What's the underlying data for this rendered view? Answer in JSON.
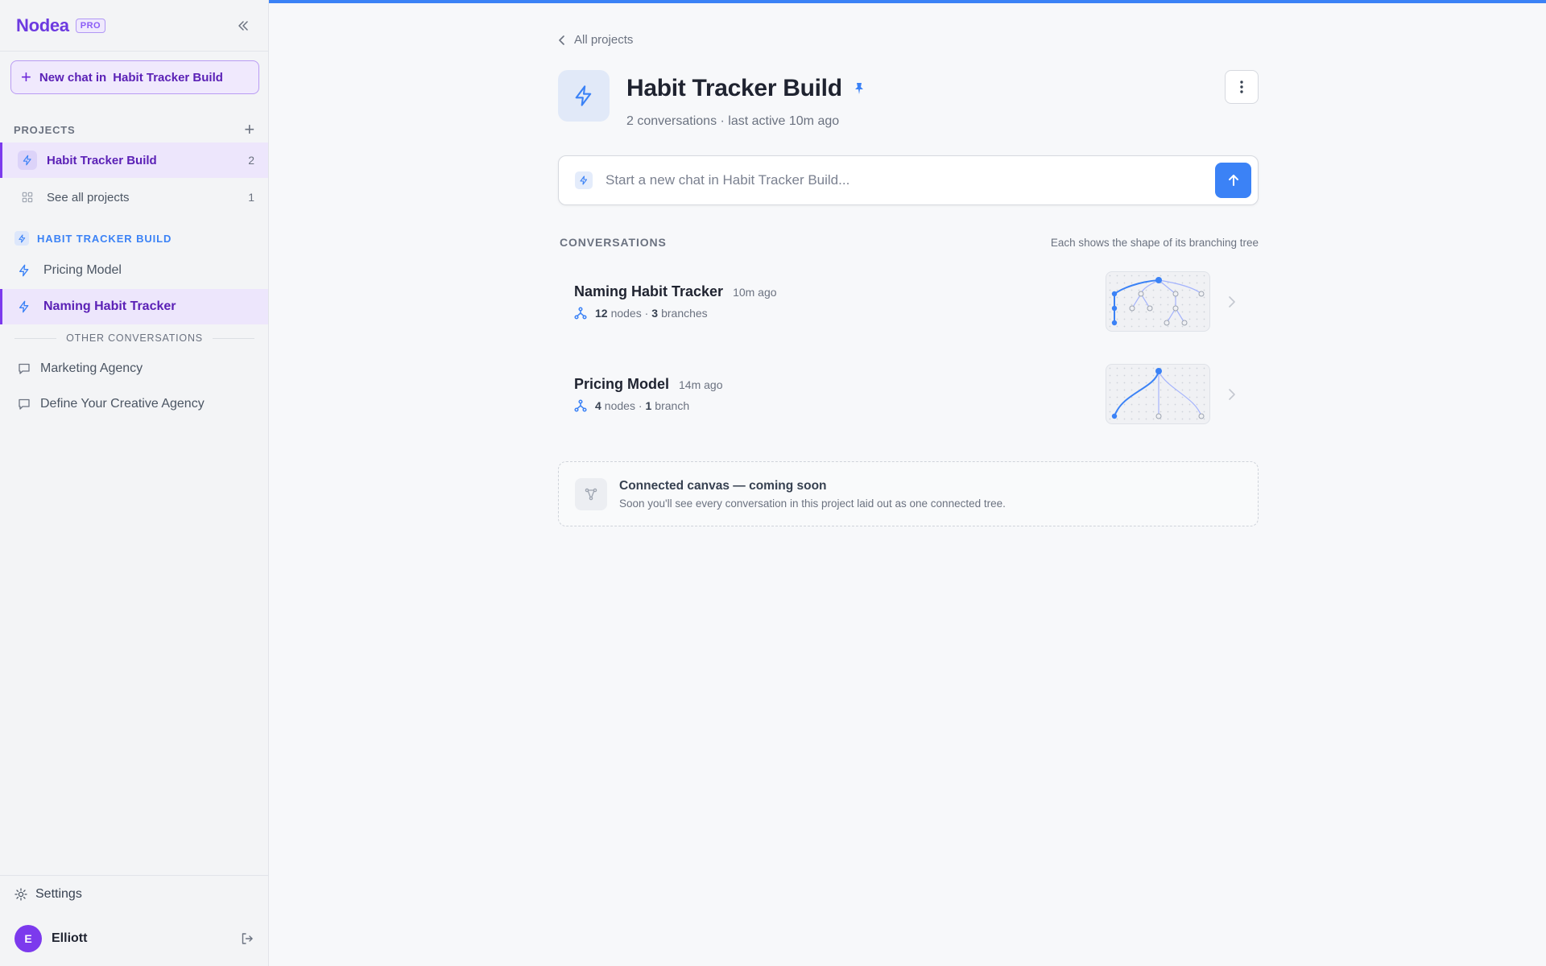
{
  "app": {
    "logo": "Nodea",
    "badge": "PRO"
  },
  "sidebar": {
    "new_chat_prefix": "New chat in",
    "new_chat_project": "Habit Tracker Build",
    "projects_heading": "PROJECTS",
    "projects": [
      {
        "label": "Habit Tracker Build",
        "count": "2",
        "active": true
      },
      {
        "label": "See all projects",
        "count": "1",
        "active": false
      }
    ],
    "group_heading": "HABIT TRACKER BUILD",
    "group_items": [
      {
        "label": "Pricing Model",
        "active": false
      },
      {
        "label": "Naming Habit Tracker",
        "active": true
      }
    ],
    "other_heading": "OTHER CONVERSATIONS",
    "other_items": [
      {
        "label": "Marketing Agency"
      },
      {
        "label": "Define Your Creative Agency"
      }
    ],
    "settings_label": "Settings",
    "user": {
      "initial": "E",
      "name": "Elliott"
    }
  },
  "main": {
    "back_label": "All projects",
    "title": "Habit Tracker Build",
    "meta": "2 conversations · last active 10m ago",
    "input_placeholder": "Start a new chat in Habit Tracker Build...",
    "conversations_heading": "CONVERSATIONS",
    "conversations_hint": "Each shows the shape of its branching tree",
    "conversations": [
      {
        "name": "Naming Habit Tracker",
        "time": "10m ago",
        "nodes": "12",
        "nodes_label": "nodes ·",
        "branches": "3",
        "branches_label": "branches"
      },
      {
        "name": "Pricing Model",
        "time": "14m ago",
        "nodes": "4",
        "nodes_label": "nodes ·",
        "branches": "1",
        "branches_label": "branch"
      }
    ],
    "canvas": {
      "title": "Connected canvas — coming soon",
      "description": "Soon you'll see every conversation in this project laid out as one connected tree."
    }
  },
  "colors": {
    "accent": "#7c3aed",
    "primary": "#3b82f6",
    "background": "#f7f8fa"
  },
  "icons": [
    "collapse-icon",
    "plus-icon",
    "bolt-icon",
    "grid-icon",
    "chat-bubble-icon",
    "gear-icon",
    "logout-icon",
    "chevron-left-icon",
    "pin-icon",
    "more-vertical-icon",
    "send-arrow-icon",
    "branch-icon",
    "chevron-right-icon",
    "canvas-icon"
  ]
}
